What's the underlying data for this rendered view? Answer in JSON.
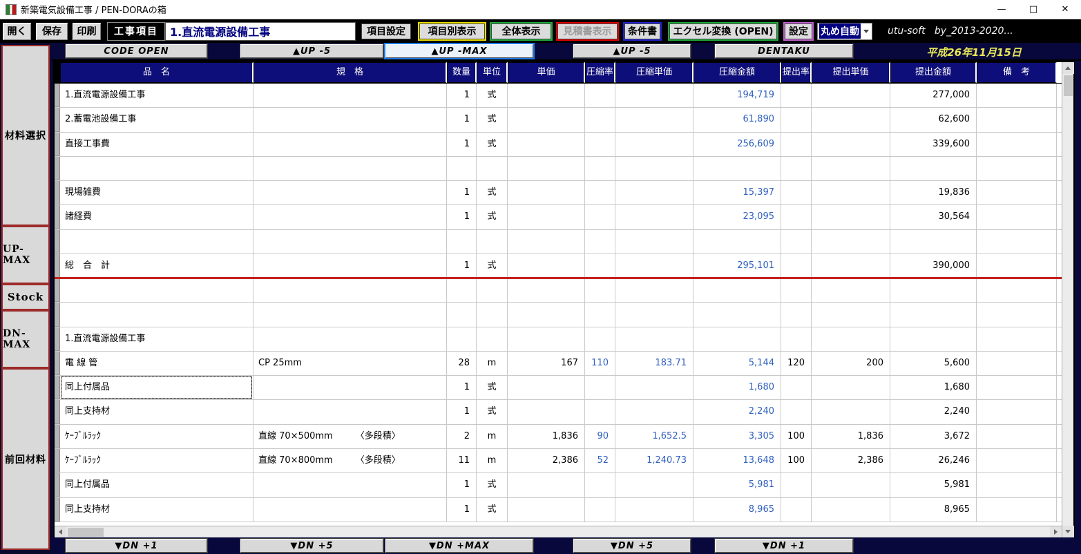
{
  "titlebar": {
    "title": "新築電気設備工事 / PEN-DORAの箱",
    "minimize_icon": "—",
    "maximize_icon": "□",
    "close_icon": "✕"
  },
  "toolbar": {
    "open": "開く",
    "save": "保存",
    "print": "印刷",
    "project_label": "工事項目",
    "project_value": "1.直流電源設備工事",
    "item_settings": "項目設定",
    "by_item_view": "項目別表示",
    "whole_view": "全体表示",
    "quote_view": "見積書表示",
    "conditions": "条件書",
    "excel_convert": "エクセル変換 (OPEN)",
    "settings": "設定",
    "rounding_value": "丸め自動",
    "credit": "utu-soft   by_2013-2020..."
  },
  "sidebar": {
    "material_select": "材料選択",
    "up_max": "UP-MAX",
    "stock": "Stock",
    "dn_max": "DN-MAX",
    "prev_material": "前回材料"
  },
  "nav_top": {
    "code_open": "CODE  OPEN",
    "up5_left": "▲UP -5",
    "up_max": "▲UP -MAX",
    "up5_right": "▲UP -5",
    "dentaku": "DENTAKU",
    "date": "平成26年11月15日"
  },
  "nav_bottom": {
    "dn1_left": "▼DN +1",
    "dn5_left": "▼DN +5",
    "dn_max": "▼DN +MAX",
    "dn5_right": "▼DN +5",
    "dn1_right": "▼DN +1"
  },
  "table": {
    "headers": [
      "品　名",
      "規　格",
      "数量",
      "単位",
      "単価",
      "圧縮率",
      "圧縮単価",
      "圧縮金額",
      "提出率",
      "提出単価",
      "提出金額",
      "備　考"
    ],
    "selected_row": 12,
    "divider_after_row": 7,
    "rows": [
      [
        "1.直流電源設備工事",
        "",
        "1",
        "式",
        "",
        "",
        "",
        "194,719",
        "",
        "",
        "277,000",
        ""
      ],
      [
        "2.蓄電池設備工事",
        "",
        "1",
        "式",
        "",
        "",
        "",
        "61,890",
        "",
        "",
        "62,600",
        ""
      ],
      [
        "直接工事費",
        "",
        "1",
        "式",
        "",
        "",
        "",
        "256,609",
        "",
        "",
        "339,600",
        ""
      ],
      [
        "",
        "",
        "",
        "",
        "",
        "",
        "",
        "",
        "",
        "",
        "",
        ""
      ],
      [
        "現場雑費",
        "",
        "1",
        "式",
        "",
        "",
        "",
        "15,397",
        "",
        "",
        "19,836",
        ""
      ],
      [
        "諸経費",
        "",
        "1",
        "式",
        "",
        "",
        "",
        "23,095",
        "",
        "",
        "30,564",
        ""
      ],
      [
        "",
        "",
        "",
        "",
        "",
        "",
        "",
        "",
        "",
        "",
        "",
        ""
      ],
      [
        "総　合　計",
        "",
        "1",
        "式",
        "",
        "",
        "",
        "295,101",
        "",
        "",
        "390,000",
        ""
      ],
      [
        "",
        "",
        "",
        "",
        "",
        "",
        "",
        "",
        "",
        "",
        "",
        ""
      ],
      [
        "",
        "",
        "",
        "",
        "",
        "",
        "",
        "",
        "",
        "",
        "",
        ""
      ],
      [
        "1.直流電源設備工事",
        "",
        "",
        "",
        "",
        "",
        "",
        "",
        "",
        "",
        "",
        ""
      ],
      [
        "電 線 管",
        "CP 25mm",
        "28",
        "m",
        "167",
        "110",
        "183.71",
        "5,144",
        "120",
        "200",
        "5,600",
        ""
      ],
      [
        "同上付属品",
        "",
        "1",
        "式",
        "",
        "",
        "",
        "1,680",
        "",
        "",
        "1,680",
        ""
      ],
      [
        "同上支持材",
        "",
        "1",
        "式",
        "",
        "",
        "",
        "2,240",
        "",
        "",
        "2,240",
        ""
      ],
      [
        "ｹｰﾌﾞﾙﾗｯｸ",
        "直線 70×500mm        〈多段積〉",
        "2",
        "m",
        "1,836",
        "90",
        "1,652.5",
        "3,305",
        "100",
        "1,836",
        "3,672",
        ""
      ],
      [
        "ｹｰﾌﾞﾙﾗｯｸ",
        "直線 70×800mm        〈多段積〉",
        "11",
        "m",
        "2,386",
        "52",
        "1,240.73",
        "13,648",
        "100",
        "2,386",
        "26,246",
        ""
      ],
      [
        "同上付属品",
        "",
        "1",
        "式",
        "",
        "",
        "",
        "5,981",
        "",
        "",
        "5,981",
        ""
      ],
      [
        "同上支持材",
        "",
        "1",
        "式",
        "",
        "",
        "",
        "8,965",
        "",
        "",
        "8,965",
        ""
      ]
    ]
  },
  "colors": {
    "header_navy": "#0e0e7a",
    "number_blue": "#3060c0",
    "divider_red": "#c52222",
    "date_yellow": "#e8e855"
  }
}
